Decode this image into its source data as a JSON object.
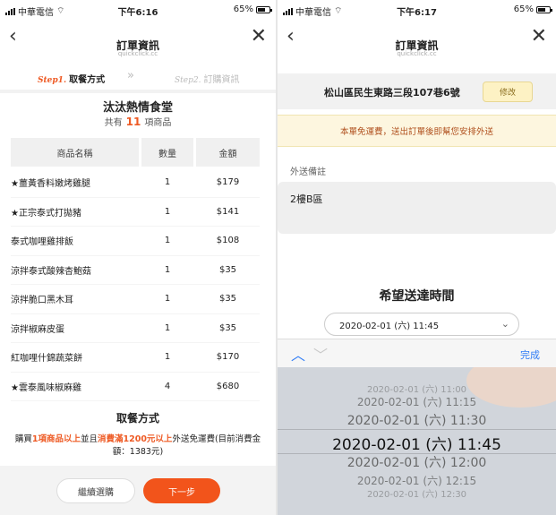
{
  "left": {
    "status": {
      "carrier": "中華電信",
      "time": "下午6:16",
      "battery": "65%",
      "battery_level": 0.65
    },
    "nav": {
      "title": "訂單資訊",
      "subtitle": "quickclick.cc"
    },
    "steps": {
      "step1_prefix": "Step1.",
      "step1_label": "取餐方式",
      "arrow": "»",
      "step2_prefix": "Step2.",
      "step2_label": "訂購資訊"
    },
    "store": {
      "name": "汰汰熱情食堂",
      "count_prefix": "共有",
      "count": "11",
      "count_suffix": "項商品"
    },
    "table": {
      "headers": [
        "商品名稱",
        "數量",
        "金額"
      ],
      "rows": [
        {
          "name": "★薑黃香料嫩烤雞腿",
          "qty": "1",
          "amount": "$179"
        },
        {
          "name": "★正宗泰式打拋豬",
          "qty": "1",
          "amount": "$141"
        },
        {
          "name": "泰式咖哩雞排飯",
          "qty": "1",
          "amount": "$108"
        },
        {
          "name": "涼拌泰式酸辣杏鮑菇",
          "qty": "1",
          "amount": "$35"
        },
        {
          "name": "涼拌脆口黑木耳",
          "qty": "1",
          "amount": "$35"
        },
        {
          "name": "涼拌椒麻皮蛋",
          "qty": "1",
          "amount": "$35"
        },
        {
          "name": "紅咖哩什錦蔬菜餅",
          "qty": "1",
          "amount": "$170"
        },
        {
          "name": "★雲泰風味椒麻雞",
          "qty": "4",
          "amount": "$680"
        }
      ]
    },
    "method": {
      "title": "取餐方式",
      "p1": "購買",
      "p2": "1項商品以上",
      "p3": "並且",
      "p4": "消費滿1200元以上",
      "p5": "外送免運費(目前消費金額：1383元)"
    },
    "footer": {
      "continue_label": "繼續選購",
      "next_label": "下一步"
    }
  },
  "right": {
    "status": {
      "carrier": "中華電信",
      "time": "下午6:17",
      "battery": "65%",
      "battery_level": 0.65
    },
    "nav": {
      "title": "訂單資訊",
      "subtitle": "quickclick.cc"
    },
    "address": {
      "text": "松山區民生東路三段107巷6號",
      "edit_label": "修改"
    },
    "notice": "本單免運費，送出訂單後即幫您安排外送",
    "note": {
      "label": "外送備註",
      "value": "2樓B區"
    },
    "delivery": {
      "title": "希望送達時間",
      "selected": "2020-02-01 (六) 11:45"
    },
    "toolbar": {
      "done_label": "完成"
    },
    "picker_options": [
      "2020-02-01 (六) 11:00",
      "2020-02-01 (六) 11:15",
      "2020-02-01 (六) 11:30",
      "2020-02-01 (六) 11:45",
      "2020-02-01 (六) 12:00",
      "2020-02-01 (六) 12:15",
      "2020-02-01 (六) 12:30"
    ]
  }
}
